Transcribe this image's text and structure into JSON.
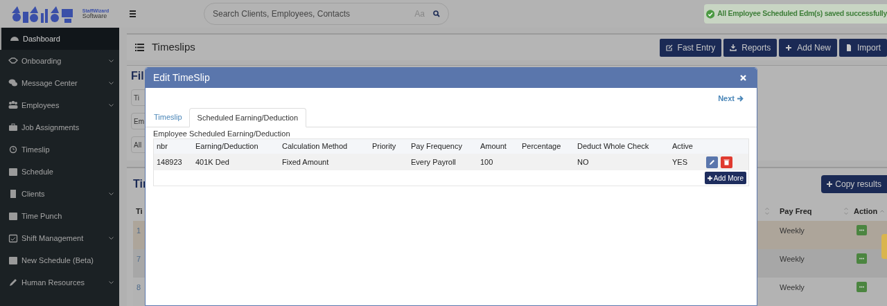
{
  "logo": {
    "name": "StaffWizard",
    "sub": "Software"
  },
  "search": {
    "placeholder": "Search Clients, Employees, Contacts",
    "case_toggle": "Aa"
  },
  "toast": {
    "message": "All Employee Scheduled Edm(s) saved successfully"
  },
  "sidebar": {
    "items": [
      {
        "label": "Dashboard",
        "has_submenu": false,
        "selected": true
      },
      {
        "label": "Onboarding",
        "has_submenu": true,
        "selected": false
      },
      {
        "label": "Message Center",
        "has_submenu": true,
        "selected": false
      },
      {
        "label": "Employees",
        "has_submenu": true,
        "selected": false
      },
      {
        "label": "Job Assignments",
        "has_submenu": false,
        "selected": false
      },
      {
        "label": "Timeslip",
        "has_submenu": false,
        "selected": false
      },
      {
        "label": "Schedule",
        "has_submenu": false,
        "selected": false
      },
      {
        "label": "Clients",
        "has_submenu": true,
        "selected": false
      },
      {
        "label": "Time Punch",
        "has_submenu": false,
        "selected": false
      },
      {
        "label": "Shift Management",
        "has_submenu": true,
        "selected": false
      },
      {
        "label": "New Schedule (Beta)",
        "has_submenu": false,
        "selected": false
      },
      {
        "label": "Human Resources",
        "has_submenu": true,
        "selected": false
      }
    ]
  },
  "page": {
    "title": "Timeslips",
    "buttons": [
      "Fast Entry",
      "Reports",
      "Add New",
      "Import"
    ]
  },
  "filters": {
    "heading": "Fil",
    "fields": [
      "Ti",
      "Em",
      "All"
    ]
  },
  "list": {
    "heading": "Tir",
    "copy_button": "Copy results",
    "columns": [
      {
        "label": "Ti"
      },
      {
        "label": "Pay Freq"
      },
      {
        "label": "Action"
      }
    ],
    "rows": [
      {
        "id": "1",
        "pay_freq": "Weekly",
        "selected": true
      },
      {
        "id": "7",
        "pay_freq": "Weekly",
        "selected": false
      },
      {
        "id": "8",
        "pay_freq": "Weekly",
        "selected": false
      }
    ]
  },
  "modal": {
    "title": "Edit TimeSlip",
    "next": "Next",
    "tabs": [
      {
        "label": "Timeslip",
        "selected": false
      },
      {
        "label": "Scheduled Earning/Deduction",
        "selected": true
      }
    ],
    "section_title": "Employee Scheduled Earning/Deduction",
    "columns": [
      "nbr",
      "Earning/Deduction",
      "Calculation Method",
      "Priority",
      "Pay Frequency",
      "Amount",
      "Percentage",
      "Deduct Whole Check",
      "Active"
    ],
    "rows": [
      [
        "148923",
        "401K Ded",
        "Fixed Amount",
        "",
        "Every Payroll",
        "100",
        "",
        "NO",
        "YES"
      ]
    ],
    "add_more": "Add More"
  }
}
